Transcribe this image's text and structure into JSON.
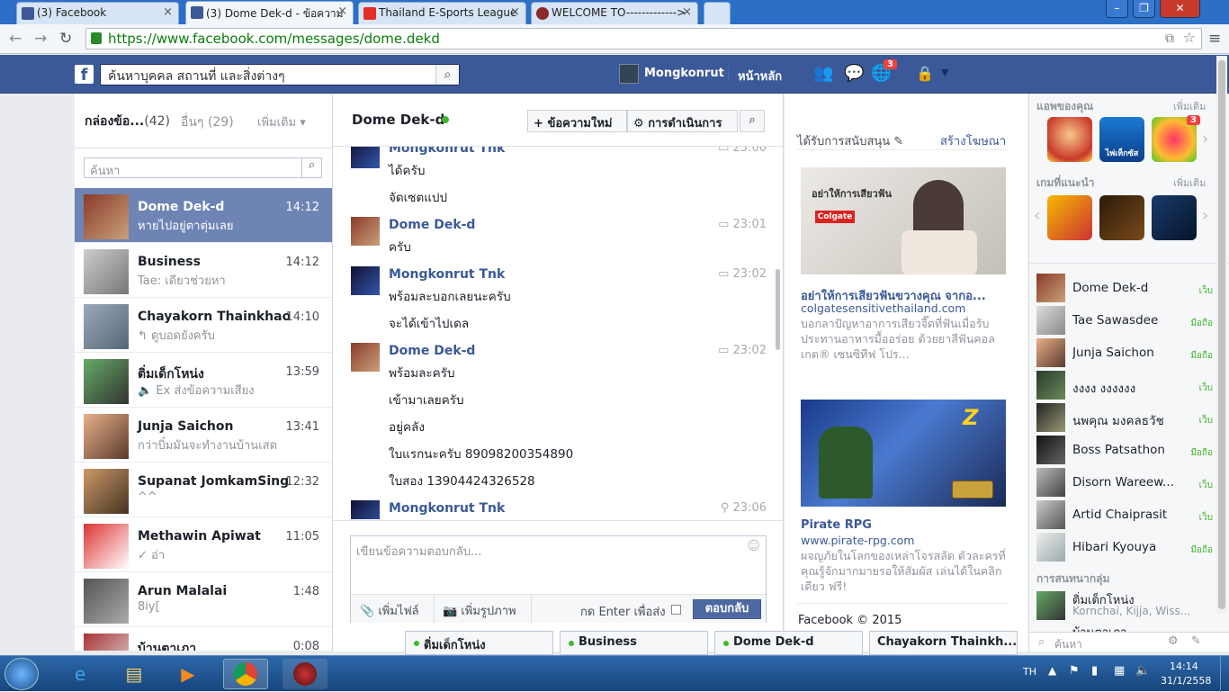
{
  "browser": {
    "tabs": [
      {
        "title": "(3) Facebook"
      },
      {
        "title": "(3) Dome Dek-d - ข้อความ"
      },
      {
        "title": "Thailand E-Sports League"
      },
      {
        "title": "WELCOME TO------------->"
      }
    ],
    "url": "https://www.facebook.com/messages/dome.dekd"
  },
  "fb": {
    "logo": "f",
    "search_placeholder": "ค้นหาบุคคล สถานที่ และสิ่งต่างๆ",
    "profile_name": "Mongkonrut",
    "home_label": "หน้าหลัก",
    "notif_count": "3"
  },
  "left": {
    "inbox_label": "กล่องข้อ...",
    "inbox_count": "(42)",
    "other_label": "อื่นๆ (29)",
    "more_label": "เพิ่มเติม",
    "search_placeholder": "ค้นหา",
    "threads": [
      {
        "name": "Dome Dek-d",
        "time": "14:12",
        "snippet": "หายไปอยู่ตาตุ่มเลย"
      },
      {
        "name": "Business",
        "time": "14:12",
        "snippet": "Tae: เดียวช่วยหา"
      },
      {
        "name": "Chayakorn Thainkhao",
        "time": "14:10",
        "snippet": "↰ ดูบอดยังครับ"
      },
      {
        "name": "ติ่มเด็กโหน่ง",
        "time": "13:59",
        "snippet": "🔈 Ex ส่งข้อความเสียง"
      },
      {
        "name": "Junja Saichon",
        "time": "13:41",
        "snippet": "กว่าบิ๋มมันจะทำงานบ้านเสด"
      },
      {
        "name": "Supanat JomkamSing",
        "time": "12:32",
        "snippet": "^^"
      },
      {
        "name": "Methawin Apiwat",
        "time": "11:05",
        "snippet": "✓ อ่า"
      },
      {
        "name": "Arun Malalai",
        "time": "1:48",
        "snippet": "8iy["
      },
      {
        "name": "บ้านตาเภา",
        "time": "0:08",
        "snippet": ""
      }
    ]
  },
  "conversation": {
    "title": "Dome Dek-d",
    "new_msg_label": "ข้อความใหม่",
    "actions_label": "การดำเนินการ",
    "messages": [
      {
        "name": "Mongkonrut Tnk",
        "time": "23:00",
        "lines": [
          "ได้ครับ",
          "จัดเซตแปป"
        ]
      },
      {
        "name": "Dome Dek-d",
        "time": "23:01",
        "lines": [
          "ครับ"
        ]
      },
      {
        "name": "Mongkonrut Tnk",
        "time": "23:02",
        "lines": [
          "พร้อมละบอกเลยนะครับ",
          "จะได้เข้าไปเดล"
        ]
      },
      {
        "name": "Dome Dek-d",
        "time": "23:02",
        "lines": [
          "พร้อมละครับ",
          "เข้ามาเลยครับ",
          "อยู่คลัง",
          "ใบแรกนะครับ 89098200354890",
          "ใบสอง 13904424326528"
        ]
      },
      {
        "name": "Mongkonrut Tnk",
        "time": "23:06",
        "lines": []
      }
    ],
    "reply_placeholder": "เขียนข้อความตอบกลับ...",
    "attach_label": "เพิ่มไฟล์",
    "photo_label": "เพิ่มรูปภาพ",
    "enter_label": "กด Enter เพื่อส่ง",
    "reply_button": "ตอบกลับ"
  },
  "ads": {
    "header": "ได้รับการสนับสนุน",
    "create_ad": "สร้างโฆษณา",
    "items": [
      {
        "title": "อย่าให้การเสียวฟันขวางคุณ จากอ...",
        "domain": "colgatesensitivethailand.com",
        "body": "บอกลาปัญหาอาการเสียวจี๊ดที่ฟันเมื่อรับประทานอาหารมื้ออร่อย ด้วยยาสีฟันคอลเกต® เซนซิทีฟ โปร...",
        "img_text": "อย่าให้การเสียวฟัน",
        "img_brand": "Colgate"
      },
      {
        "title": "Pirate RPG",
        "domain": "www.pirate-rpg.com",
        "body": "ผจญภัยในโลกของเหล่าโจรสลัด ตัวละครที่คุณรู้จักมากมายรอให้สัมผัส เล่นได้ในคลิกเดียว ฟรี!",
        "img_text": "Z"
      }
    ],
    "copyright": "Facebook © 2015"
  },
  "right": {
    "apps_label": "แอพของคุณ",
    "apps_more": "เพิ่มเติม",
    "apps_badge": "3",
    "games_label": "เกมที่แนะนำ",
    "games_more": "เพิ่มเติม",
    "poker_label": "ไพ่เท็กซัส",
    "chat": [
      {
        "name": "Dome Dek-d",
        "status": "เว็บ"
      },
      {
        "name": "Tae Sawasdee",
        "status": "มือถือ"
      },
      {
        "name": "Junja Saichon",
        "status": "มือถือ"
      },
      {
        "name": "งงงง งงงงงง",
        "status": "เว็บ"
      },
      {
        "name": "นพคุณ มงคลธวัช",
        "status": "เว็บ"
      },
      {
        "name": "Boss Patsathon",
        "status": "มือถือ"
      },
      {
        "name": "Disorn Wareew...",
        "status": "เว็บ"
      },
      {
        "name": "Artid Chaiprasit",
        "status": "เว็บ"
      },
      {
        "name": "Hibari Kyouya",
        "status": "มือถือ"
      }
    ],
    "groups_label": "การสนทนากลุ่ม",
    "group_name": "ติ่มเด็กโหน่ง",
    "group_members": "Kornchai, Kijja, Wiss...",
    "group2_name": "บ้านตาเภา",
    "chat_search": "ค้นหา"
  },
  "dock": [
    {
      "name": "ติ่มเด็กโหน่ง"
    },
    {
      "name": "Business"
    },
    {
      "name": "Dome Dek-d"
    },
    {
      "name": "Chayakorn Thainkh..."
    }
  ],
  "taskbar": {
    "lang": "TH",
    "time": "14:14",
    "date": "31/1/2558"
  }
}
